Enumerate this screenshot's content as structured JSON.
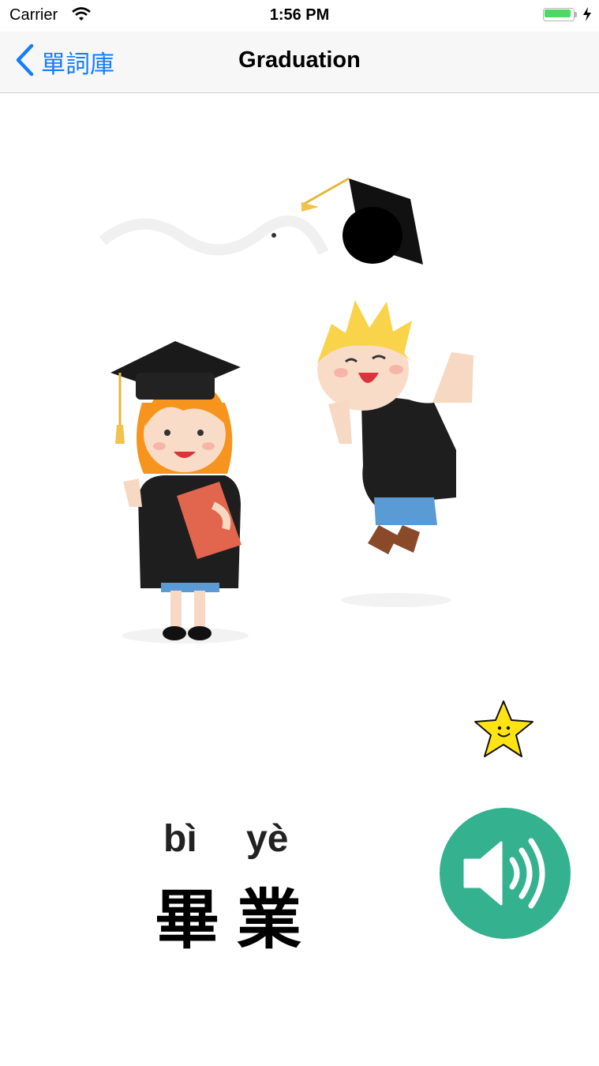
{
  "status_bar": {
    "carrier": "Carrier",
    "time": "1:56 PM"
  },
  "nav": {
    "back_label": "單詞庫",
    "title": "Graduation"
  },
  "word": {
    "pinyin": [
      "bì",
      "yè"
    ],
    "characters": "畢業"
  },
  "colors": {
    "accent": "#147efb",
    "sound_button": "#34b18f",
    "star": "#ffe414"
  },
  "icons": {
    "back": "chevron-left-icon",
    "favorite": "star-icon",
    "play": "speaker-icon"
  }
}
